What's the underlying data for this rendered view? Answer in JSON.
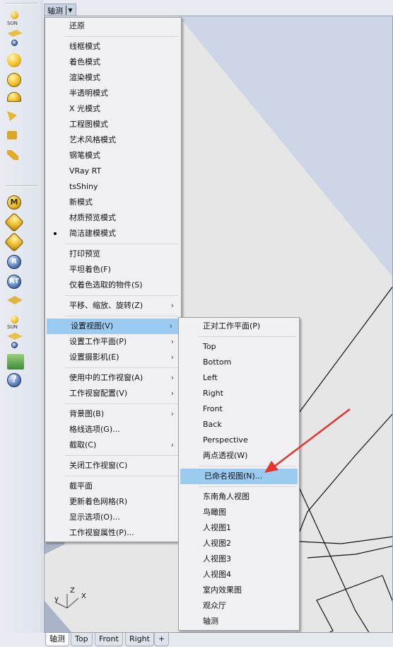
{
  "viewport": {
    "title": "轴测",
    "axis_labels": {
      "x": "X",
      "y": "y",
      "z": "Z"
    }
  },
  "toolbar": {
    "sun_label": "SUN",
    "sun_label2": "SUN",
    "m_label": "M",
    "r_label": "R",
    "rt_label": "RT",
    "help_label": "?"
  },
  "main_menu": {
    "groups": [
      [
        {
          "label": "还原"
        }
      ],
      [
        {
          "label": "线框模式"
        },
        {
          "label": "着色模式"
        },
        {
          "label": "渲染模式"
        },
        {
          "label": "半透明模式"
        },
        {
          "label": "X 光模式"
        },
        {
          "label": "工程图模式"
        },
        {
          "label": "艺术风格模式"
        },
        {
          "label": "钢笔模式"
        },
        {
          "label": "VRay RT"
        },
        {
          "label": "tsShiny"
        },
        {
          "label": "新模式"
        },
        {
          "label": "材质预览模式"
        },
        {
          "label": "简洁建模模式",
          "checked": true
        }
      ],
      [
        {
          "label": "打印预览"
        },
        {
          "label": "平坦着色(F)"
        },
        {
          "label": "仅着色选取的物件(S)"
        }
      ],
      [
        {
          "label": "平移、缩放、旋转(Z)",
          "submenu": true
        }
      ],
      [
        {
          "label": "设置视图(V)",
          "submenu": true,
          "highlighted": true
        },
        {
          "label": "设置工作平面(P)",
          "submenu": true
        },
        {
          "label": "设置摄影机(E)",
          "submenu": true
        }
      ],
      [
        {
          "label": "使用中的工作视窗(A)",
          "submenu": true
        },
        {
          "label": "工作视窗配置(V)",
          "submenu": true
        }
      ],
      [
        {
          "label": "背景图(B)",
          "submenu": true
        },
        {
          "label": "格线选项(G)..."
        },
        {
          "label": "截取(C)",
          "submenu": true
        }
      ],
      [
        {
          "label": "关闭工作视窗(C)"
        }
      ],
      [
        {
          "label": "截平面"
        },
        {
          "label": "更新着色网格(R)"
        },
        {
          "label": "显示选项(O)..."
        },
        {
          "label": "工作视窗属性(P)..."
        }
      ]
    ]
  },
  "view_submenu": {
    "groups": [
      [
        {
          "label": "正对工作平面(P)"
        }
      ],
      [
        {
          "label": "Top"
        },
        {
          "label": "Bottom"
        },
        {
          "label": "Left"
        },
        {
          "label": "Right"
        },
        {
          "label": "Front"
        },
        {
          "label": "Back"
        },
        {
          "label": "Perspective"
        },
        {
          "label": "两点透视(W)"
        }
      ],
      [
        {
          "label": "已命名视图(N)...",
          "highlighted": true
        }
      ],
      [
        {
          "label": "东南角人视图"
        },
        {
          "label": "鸟瞰图"
        },
        {
          "label": "人视图1"
        },
        {
          "label": "人视图2"
        },
        {
          "label": "人视图3"
        },
        {
          "label": "人视图4"
        },
        {
          "label": "室内效果图"
        },
        {
          "label": "观众厅"
        },
        {
          "label": "轴测"
        }
      ]
    ]
  },
  "tabs": [
    {
      "label": "轴测",
      "active": true
    },
    {
      "label": "Top"
    },
    {
      "label": "Front"
    },
    {
      "label": "Right"
    },
    {
      "label": "+"
    }
  ],
  "colors": {
    "highlight": "#9ccbf1",
    "annotation_arrow": "#e8322c"
  }
}
